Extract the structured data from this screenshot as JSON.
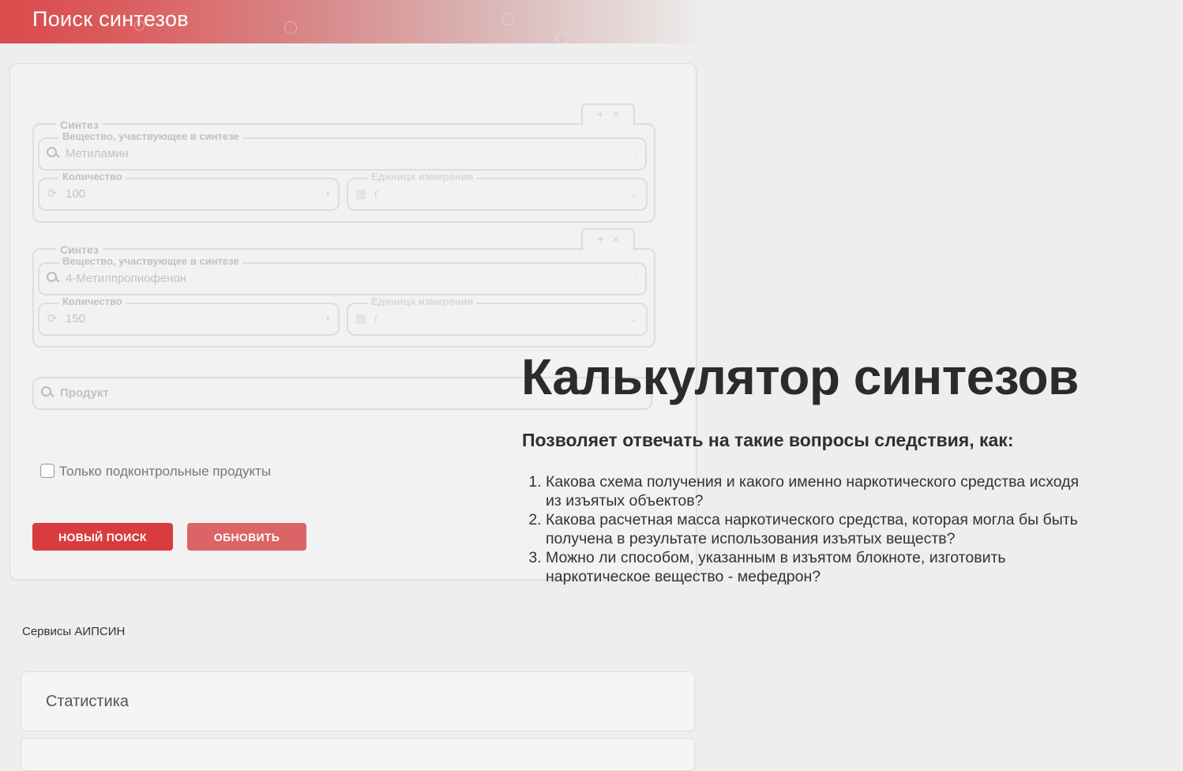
{
  "header": {
    "title": "Поиск синтезов"
  },
  "syntheses": [
    {
      "legend": "Синтез",
      "tab_add": "+",
      "tab_remove": "×",
      "substance": {
        "label": "Вещество, участвующее в синтезе",
        "value": "Метиламин"
      },
      "quantity": {
        "label": "Количество",
        "value": "100"
      },
      "unit": {
        "label": "Единица измерения",
        "value": "г"
      }
    },
    {
      "legend": "Синтез",
      "tab_add": "+",
      "tab_remove": "×",
      "substance": {
        "label": "Вещество, участвующее в синтезе",
        "value": "4-Метилпропиофенон"
      },
      "quantity": {
        "label": "Количество",
        "value": "150"
      },
      "unit": {
        "label": "Единица измерения",
        "value": "г"
      }
    }
  ],
  "product": {
    "placeholder": "Продукт"
  },
  "controlled_only": {
    "label": "Только подконтрольные продукты",
    "checked": false
  },
  "buttons": {
    "new_search": "НОВЫЙ ПОИСК",
    "refresh": "ОБНОВИТЬ"
  },
  "services": {
    "title": "Сервисы АИПСИН",
    "statistics": "Статистика"
  },
  "overlay": {
    "title": "Калькулятор синтезов",
    "subtitle": "Позволяет отвечать на такие вопросы следствия, как:",
    "items": [
      "Какова схема получения и какого именно наркотического средства исходя из изъятых объектов?",
      "Какова расчетная масса наркотического средства, которая могла бы быть получена в результате использования изъятых веществ?",
      "Можно ли способом, указанным в изъятом блокноте, изготовить наркотическое вещество - мефедрон?"
    ]
  },
  "colors": {
    "brand_red": "#d93c3e",
    "button_refresh": "#dc6466",
    "background": "#eeeeee"
  }
}
